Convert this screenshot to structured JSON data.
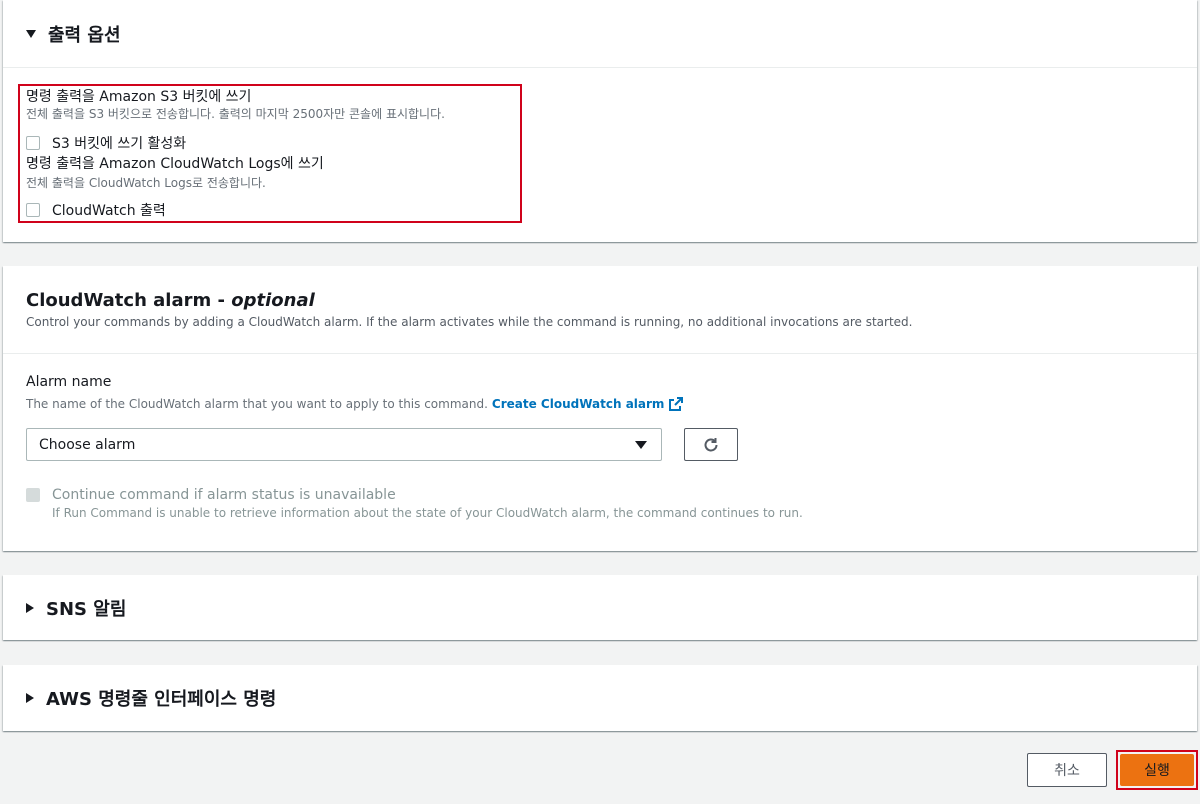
{
  "output_options": {
    "title": "출력 옵션",
    "s3": {
      "title": "명령 출력을 Amazon S3 버킷에 쓰기",
      "desc": "전체 출력을 S3 버킷으로 전송합니다. 출력의 마지막 2500자만 콘솔에 표시합니다.",
      "checkbox_label": "S3 버킷에 쓰기 활성화"
    },
    "cloudwatch": {
      "title": "명령 출력을 Amazon CloudWatch Logs에 쓰기",
      "desc": "전체 출력을 CloudWatch Logs로 전송합니다.",
      "checkbox_label": "CloudWatch 출력"
    }
  },
  "alarm": {
    "title": "CloudWatch alarm - ",
    "title_optional": "optional",
    "desc": "Control your commands by adding a CloudWatch alarm. If the alarm activates while the command is running, no additional invocations are started.",
    "name_label": "Alarm name",
    "name_desc": "The name of the CloudWatch alarm that you want to apply to this command. ",
    "create_link": "Create CloudWatch alarm",
    "select_value": "Choose alarm",
    "continue_label": "Continue command if alarm status is unavailable",
    "continue_desc": "If Run Command is unable to retrieve information about the state of your CloudWatch alarm, the command continues to run."
  },
  "sns": {
    "title": "SNS 알림"
  },
  "cli": {
    "title": "AWS 명령줄 인터페이스 명령"
  },
  "footer": {
    "cancel_label": "취소",
    "run_label": "실행"
  },
  "colors": {
    "primary_button": "#ec7211",
    "link": "#0073bb",
    "highlight": "#d0021b"
  }
}
